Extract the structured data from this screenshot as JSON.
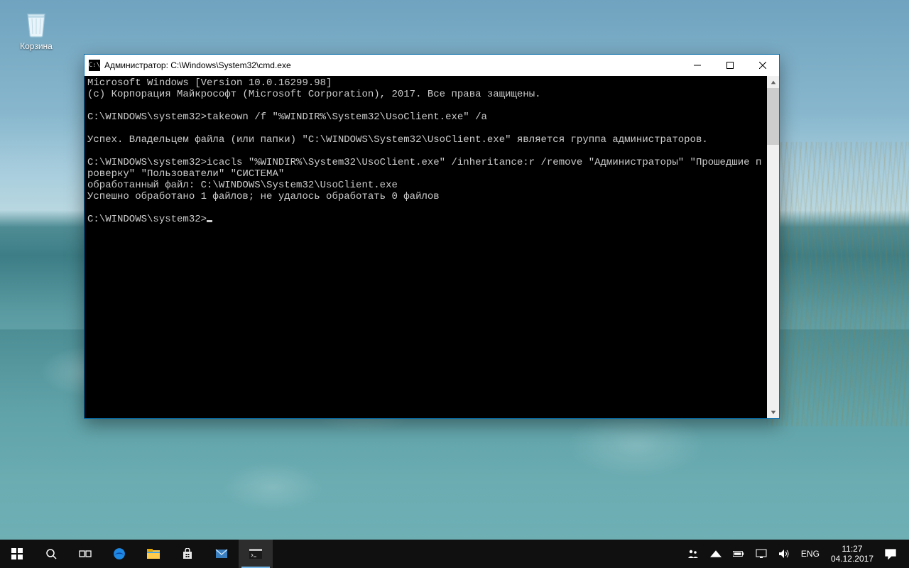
{
  "desktop": {
    "recycle_bin_label": "Корзина"
  },
  "window": {
    "title": "Администратор: C:\\Windows\\System32\\cmd.exe",
    "icon_text": "C:\\",
    "terminal_lines": [
      "Microsoft Windows [Version 10.0.16299.98]",
      "(c) Корпорация Майкрософт (Microsoft Corporation), 2017. Все права защищены.",
      "",
      "C:\\WINDOWS\\system32>takeown /f \"%WINDIR%\\System32\\UsoClient.exe\" /a",
      "",
      "Успех. Владельцем файла (или папки) \"C:\\WINDOWS\\System32\\UsoClient.exe\" является группа администраторов.",
      "",
      "C:\\WINDOWS\\system32>icacls \"%WINDIR%\\System32\\UsoClient.exe\" /inheritance:r /remove \"Администраторы\" \"Прошедшие проверку\" \"Пользователи\" \"СИСТЕМА\"",
      "обработанный файл: C:\\WINDOWS\\System32\\UsoClient.exe",
      "Успешно обработано 1 файлов; не удалось обработать 0 файлов",
      "",
      "C:\\WINDOWS\\system32>"
    ]
  },
  "taskbar": {
    "language": "ENG",
    "time": "11:27",
    "date": "04.12.2017"
  }
}
